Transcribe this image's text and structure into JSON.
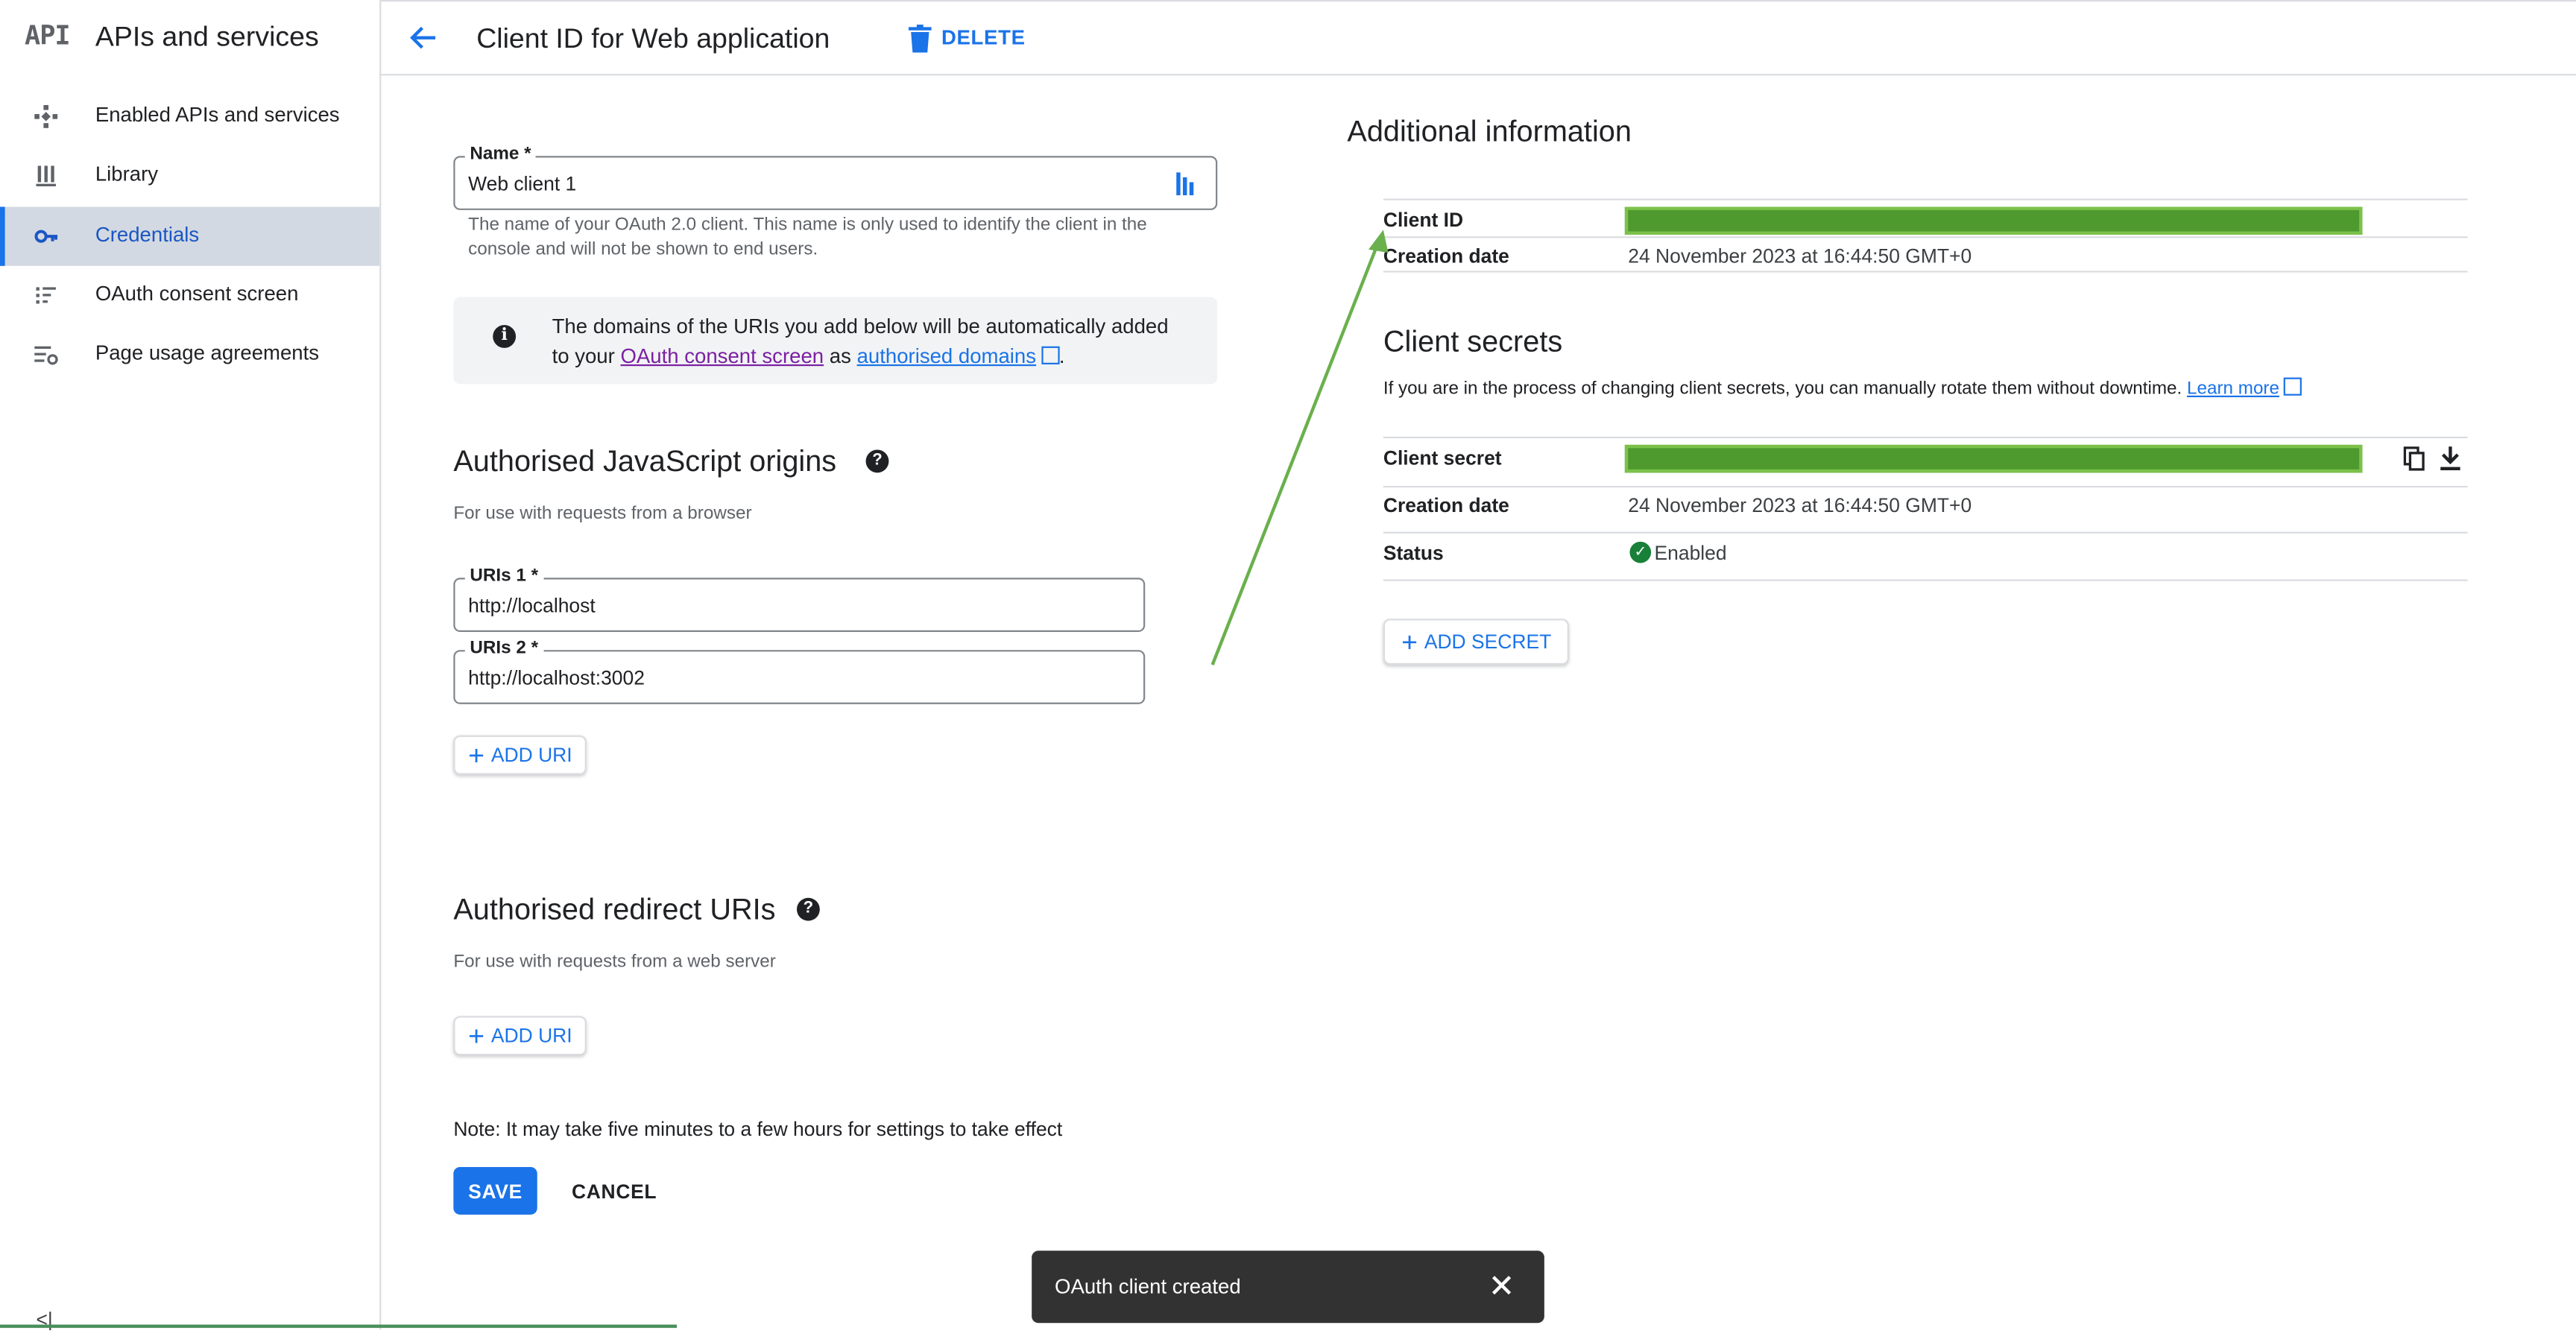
{
  "sidebar": {
    "logo": "API",
    "title": "APIs and services",
    "items": [
      {
        "label": "Enabled APIs and services",
        "icon": "enabled-apis-icon"
      },
      {
        "label": "Library",
        "icon": "library-icon"
      },
      {
        "label": "Credentials",
        "icon": "key-icon",
        "active": true
      },
      {
        "label": "OAuth consent screen",
        "icon": "consent-screen-icon"
      },
      {
        "label": "Page usage agreements",
        "icon": "usage-agreements-icon"
      }
    ],
    "collapse_label": "<|"
  },
  "header": {
    "title": "Client ID for Web application",
    "delete_label": "DELETE"
  },
  "form": {
    "name": {
      "label": "Name *",
      "value": "Web client 1"
    },
    "name_hint": "The name of your OAuth 2.0 client. This name is only used to identify the client in the console and will not be shown to end users.",
    "info": {
      "text_before": "The domains of the URIs you add below will be automatically added to your",
      "link1": "OAuth consent screen",
      "text_mid": "as",
      "link2": "authorised domains",
      "text_after": "."
    },
    "js_origins": {
      "title": "Authorised JavaScript origins",
      "subtitle": "For use with requests from a browser",
      "uris": [
        {
          "label": "URIs 1 *",
          "value": "http://localhost"
        },
        {
          "label": "URIs 2 *",
          "value": "http://localhost:3002"
        }
      ],
      "add_label": "ADD URI"
    },
    "redirect_uris": {
      "title": "Authorised redirect URIs",
      "subtitle": "For use with requests from a web server",
      "add_label": "ADD URI"
    },
    "note": "Note: It may take five minutes to a few hours for settings to take effect",
    "save_label": "SAVE",
    "cancel_label": "CANCEL"
  },
  "additional_info": {
    "title": "Additional information",
    "client_id_label": "Client ID",
    "creation_date_label": "Creation date",
    "creation_date": "24 November 2023 at 16:44:50 GMT+0"
  },
  "client_secrets": {
    "title": "Client secrets",
    "description": "If you are in the process of changing client secrets, you can manually rotate them without downtime.",
    "learn_more": "Learn more",
    "secret_label": "Client secret",
    "creation_date_label": "Creation date",
    "creation_date": "24 November 2023 at 16:44:50 GMT+0",
    "status_label": "Status",
    "status_value": "Enabled",
    "add_secret_label": "ADD SECRET"
  },
  "snackbar": {
    "text": "OAuth client created"
  },
  "colors": {
    "accent": "#1a73e8",
    "redaction": "#4f9a2f",
    "annotation_arrow": "#6ab04c"
  }
}
